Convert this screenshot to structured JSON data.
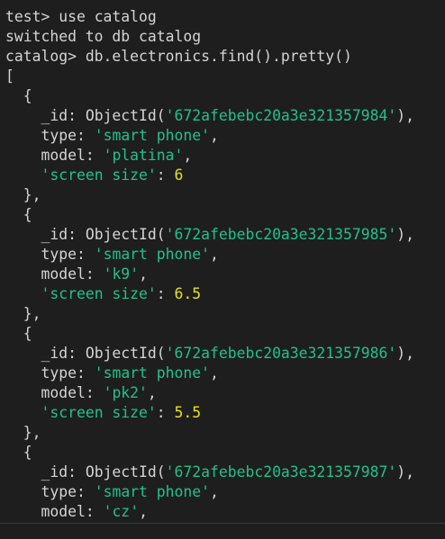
{
  "terminal": {
    "commands": [
      {
        "prompt": "test> ",
        "command": "use catalog"
      },
      {
        "output": "switched to db catalog"
      },
      {
        "prompt": "catalog> ",
        "command": "db.electronics.find().pretty()"
      }
    ],
    "open_bracket": "[",
    "documents": [
      {
        "id": "672afebebc20a3e321357984",
        "type": "smart phone",
        "model": "platina",
        "screen_size": "6"
      },
      {
        "id": "672afebebc20a3e321357985",
        "type": "smart phone",
        "model": "k9",
        "screen_size": "6.5"
      },
      {
        "id": "672afebebc20a3e321357986",
        "type": "smart phone",
        "model": "pk2",
        "screen_size": "5.5"
      },
      {
        "id": "672afebebc20a3e321357987",
        "type": "smart phone",
        "model": "cz"
      }
    ],
    "colors": {
      "background": "#1e1e1e",
      "text": "#d4d4d4",
      "string": "#23c18a",
      "number": "#e5e510"
    }
  }
}
